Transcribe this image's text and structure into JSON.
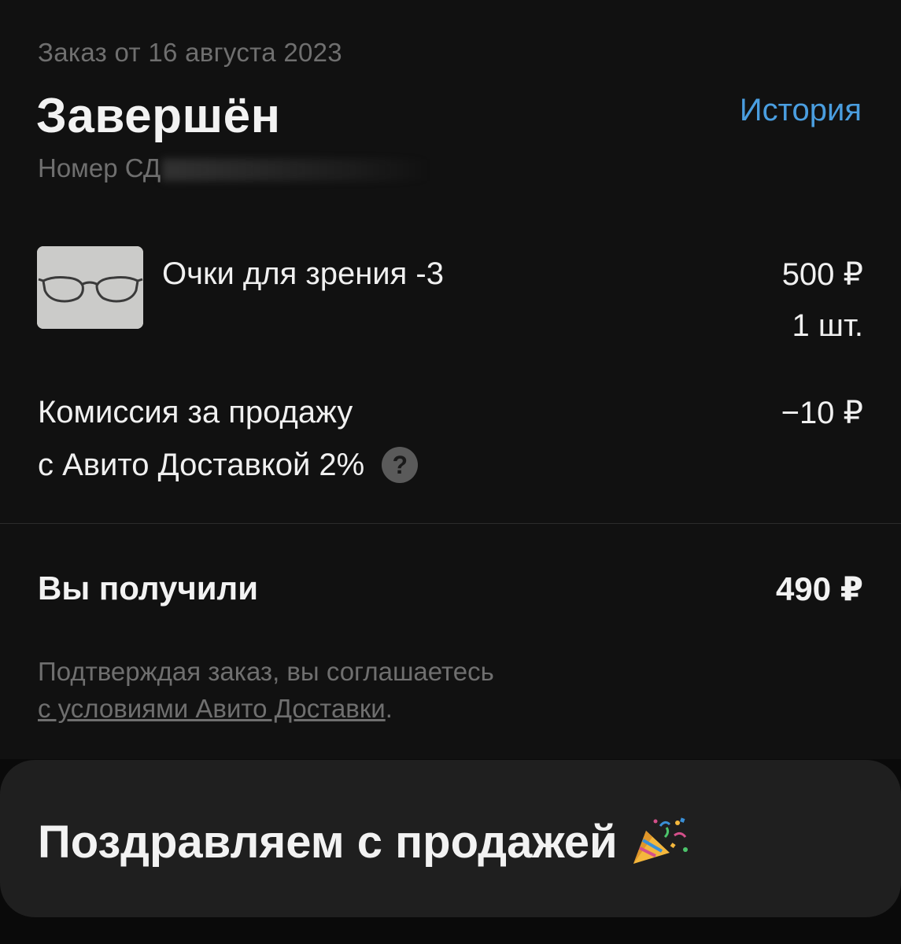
{
  "order": {
    "date": "Заказ от 16 августа 2023",
    "status": "Завершён",
    "history_link": "История",
    "tracking_label": "Номер СД"
  },
  "item": {
    "name": "Очки для зрения -3",
    "price": "500 ₽",
    "quantity": "1 шт.",
    "thumbnail_icon": "eyeglasses-photo"
  },
  "commission": {
    "line1": "Комиссия за продажу",
    "line2": "с Авито Доставкой 2%",
    "amount": "−10 ₽",
    "help_icon": "?"
  },
  "total": {
    "label": "Вы получили",
    "amount": "490 ₽"
  },
  "terms": {
    "text": "Подтверждая заказ, вы соглашаетесь",
    "link": "с условиями Авито Доставки",
    "suffix": "."
  },
  "congrats": {
    "text": "Поздравляем с продажей",
    "icon": "party-popper-icon"
  },
  "colors": {
    "accent_link": "#4a9ee0",
    "muted_text": "#6f6f6f",
    "background": "#111111",
    "card": "#1f1f1f"
  }
}
